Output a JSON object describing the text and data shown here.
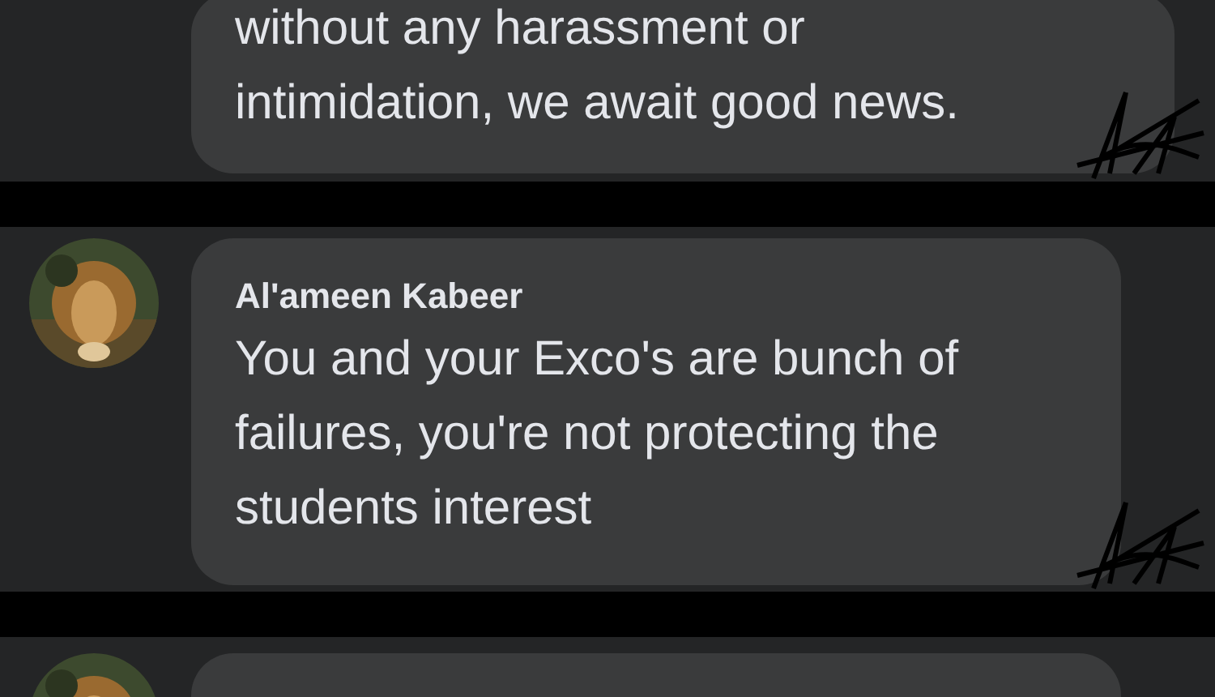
{
  "comments": [
    {
      "lines": [
        "without any harassment or",
        "intimidation, we await good news."
      ]
    },
    {
      "author": "Al'ameen Kabeer",
      "avatar": {
        "kind": "picture"
      },
      "lines": [
        "You and your Exco's are bunch of",
        "failures, you're not protecting the",
        "students interest"
      ]
    },
    {
      "avatar": {
        "kind": "picture"
      }
    }
  ]
}
